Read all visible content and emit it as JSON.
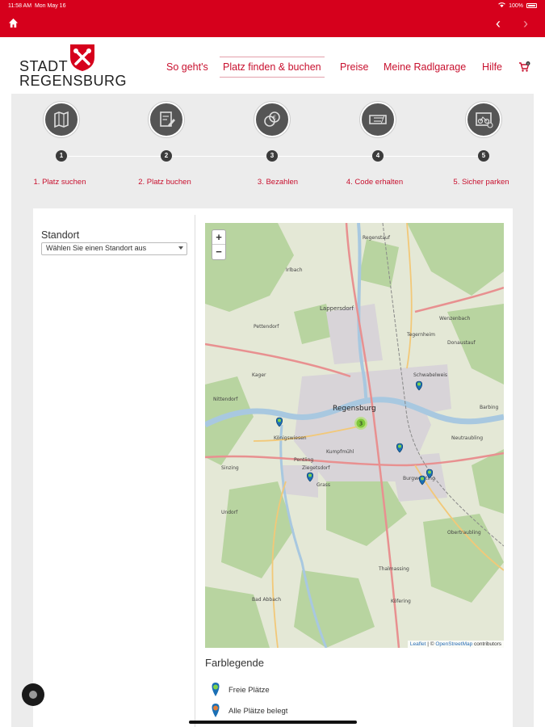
{
  "statusbar": {
    "time": "11:58 AM",
    "date": "Mon May 16",
    "battery": "100%"
  },
  "header": {
    "logo_line1": "STADT",
    "logo_line2": "REGENSBURG"
  },
  "nav": [
    {
      "label": "So geht's",
      "active": false
    },
    {
      "label": "Platz finden & buchen",
      "active": true
    },
    {
      "label": "Preise",
      "active": false
    },
    {
      "label": "Meine Radlgarage",
      "active": false
    },
    {
      "label": "Hilfe",
      "active": false
    }
  ],
  "cart": {
    "count": "0"
  },
  "steps": [
    {
      "number": "1",
      "label": "1. Platz suchen",
      "icon": "map-search-icon"
    },
    {
      "number": "2",
      "label": "2. Platz buchen",
      "icon": "edit-document-icon"
    },
    {
      "number": "3",
      "label": "3. Bezahlen",
      "icon": "coins-icon"
    },
    {
      "number": "4",
      "label": "4. Code erhalten",
      "icon": "ticket-icon"
    },
    {
      "number": "5",
      "label": "5. Sicher parken",
      "icon": "bike-garage-icon"
    }
  ],
  "form": {
    "standort_label": "Standort",
    "select_value": "Wählen Sie einen Standort aus"
  },
  "map": {
    "zoom_in": "+",
    "zoom_out": "−",
    "cluster_count": "3",
    "attribution_leaflet": "Leaflet",
    "attribution_sep": " | © ",
    "attribution_osm": "OpenStreetMap",
    "attribution_rest": " contributors",
    "places": [
      "Regenstauf",
      "Lappersdorf",
      "Regensburg",
      "Neutraubling",
      "Bad Abbach",
      "Pentling",
      "Sinzing",
      "Wenzenbach",
      "Barbing",
      "Obertraubling",
      "Tegernheim",
      "Donaustauf",
      "Pettendorf",
      "Nittendorf",
      "Thalmassing",
      "Köfering",
      "Grass",
      "Burgweinting",
      "Königswiesen",
      "Ziegetsdorf",
      "Kumpfmühl",
      "Schwabelweis",
      "Kager",
      "Undorf",
      "Irlbach"
    ]
  },
  "legend": {
    "title": "Farblegende",
    "items": [
      {
        "label": "Freie Plätze",
        "color": "#1a9bd4"
      },
      {
        "label": "Alle Plätze belegt",
        "color": "#e07b39"
      }
    ]
  },
  "colors": {
    "brand": "#d6001c",
    "link": "#c8102e"
  }
}
